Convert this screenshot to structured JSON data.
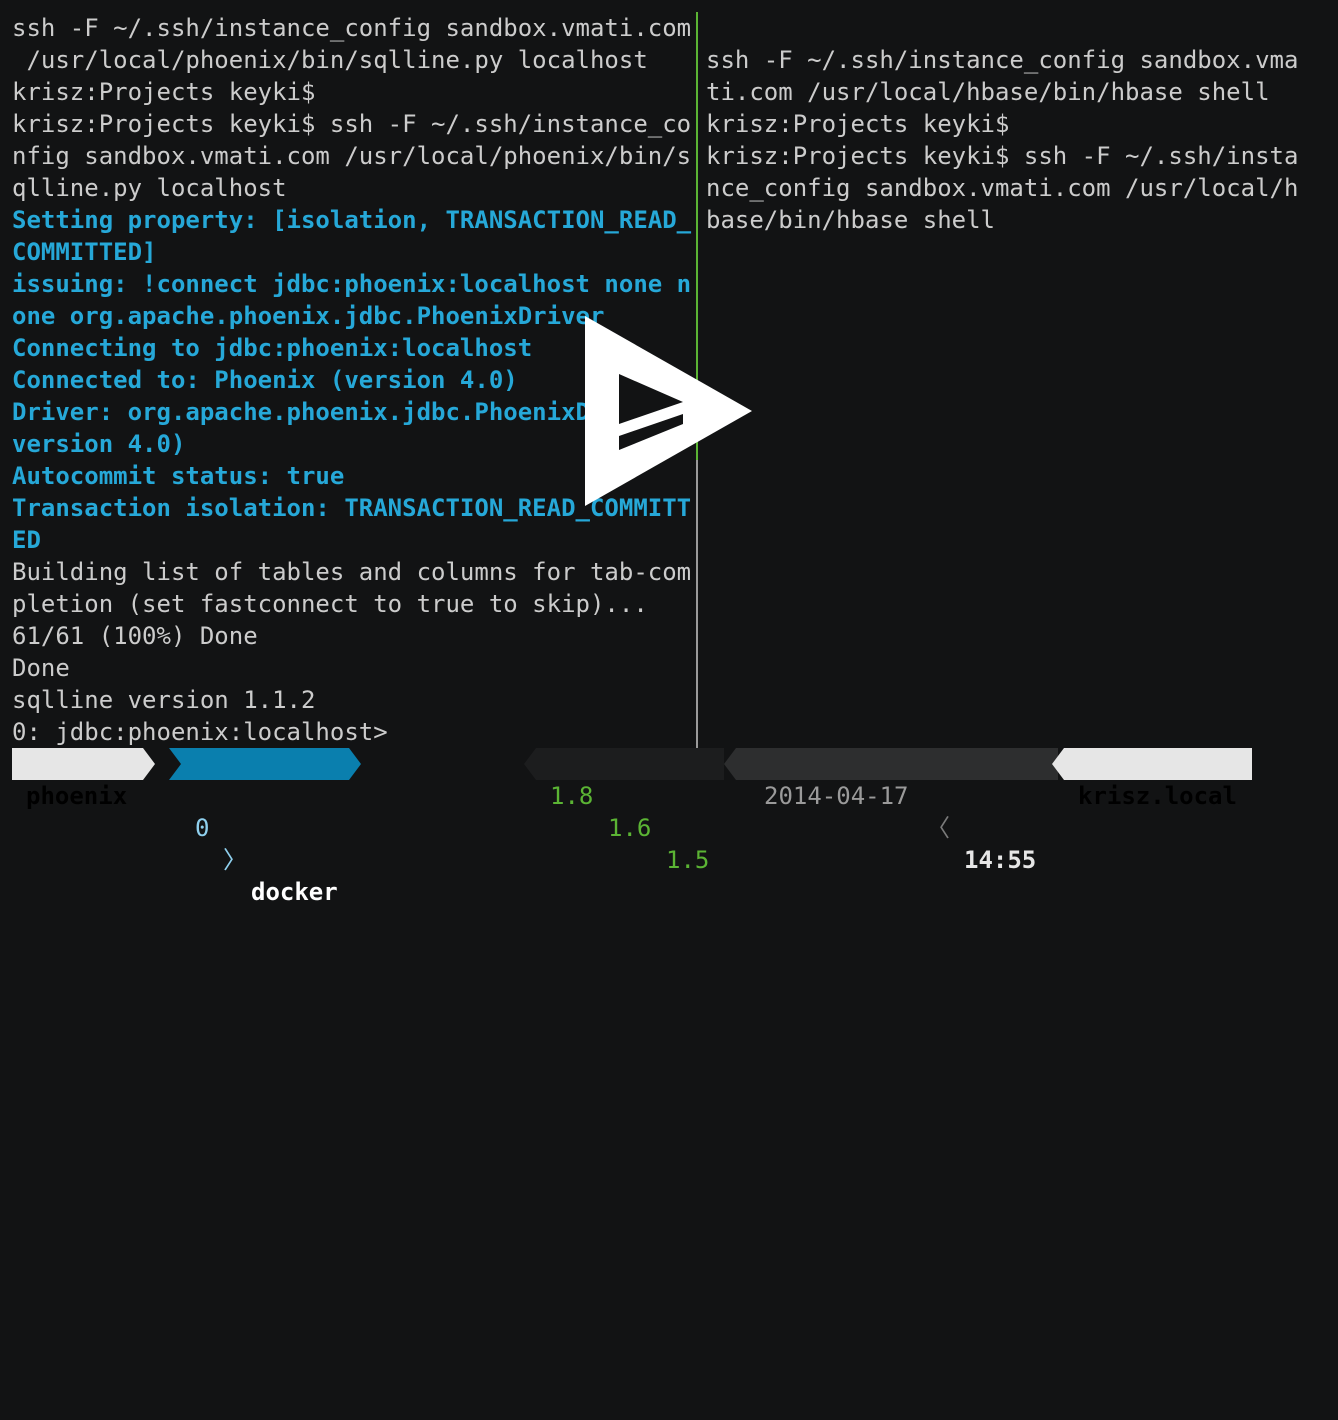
{
  "left_pane": {
    "lines": [
      {
        "text": "ssh -F ~/.ssh/instance_config sandbox.vmati.com",
        "style": "normal"
      },
      {
        "text": " /usr/local/phoenix/bin/sqlline.py localhost",
        "style": "normal"
      },
      {
        "text": "krisz:Projects keyki$",
        "style": "normal"
      },
      {
        "text": "krisz:Projects keyki$ ssh -F ~/.ssh/instance_co",
        "style": "normal"
      },
      {
        "text": "nfig sandbox.vmati.com /usr/local/phoenix/bin/s",
        "style": "normal"
      },
      {
        "text": "qlline.py localhost",
        "style": "normal"
      },
      {
        "text": "Setting property: [isolation, TRANSACTION_READ_",
        "style": "hl"
      },
      {
        "text": "COMMITTED]",
        "style": "hl"
      },
      {
        "text": "issuing: !connect jdbc:phoenix:localhost none n",
        "style": "hl"
      },
      {
        "text": "one org.apache.phoenix.jdbc.PhoenixDriver",
        "style": "hl"
      },
      {
        "text": "Connecting to jdbc:phoenix:localhost",
        "style": "hl"
      },
      {
        "text": "Connected to: Phoenix (version 4.0)",
        "style": "hl"
      },
      {
        "text": "Driver: org.apache.phoenix.jdbc.PhoenixDriver (",
        "style": "hl"
      },
      {
        "text": "version 4.0)",
        "style": "hl"
      },
      {
        "text": "Autocommit status: true",
        "style": "hl"
      },
      {
        "text": "Transaction isolation: TRANSACTION_READ_COMMITT",
        "style": "hl"
      },
      {
        "text": "ED",
        "style": "hl"
      },
      {
        "text": "Building list of tables and columns for tab-com",
        "style": "normal"
      },
      {
        "text": "pletion (set fastconnect to true to skip)...",
        "style": "normal"
      },
      {
        "text": "61/61 (100%) Done",
        "style": "normal"
      },
      {
        "text": "Done",
        "style": "normal"
      },
      {
        "text": "sqlline version 1.1.2",
        "style": "normal"
      },
      {
        "text": "0: jdbc:phoenix:localhost>",
        "style": "normal"
      }
    ]
  },
  "right_pane": {
    "lines": [
      {
        "text": "",
        "style": "normal"
      },
      {
        "text": "ssh -F ~/.ssh/instance_config sandbox.vma",
        "style": "normal"
      },
      {
        "text": "ti.com /usr/local/hbase/bin/hbase shell",
        "style": "normal"
      },
      {
        "text": "krisz:Projects keyki$",
        "style": "normal"
      },
      {
        "text": "krisz:Projects keyki$ ssh -F ~/.ssh/insta",
        "style": "normal"
      },
      {
        "text": "nce_config sandbox.vmati.com /usr/local/h",
        "style": "normal"
      },
      {
        "text": "base/bin/hbase shell",
        "style": "normal"
      }
    ]
  },
  "status_bar": {
    "session": "phoenix",
    "window_index": "0",
    "window_name": "docker",
    "load_1": "1.8",
    "load_5": "1.6",
    "load_15": "1.5",
    "date": "2014-04-17",
    "time": "14:55",
    "hostname": "krisz.local"
  },
  "overlay": {
    "icon": "play-icon"
  },
  "colors": {
    "background": "#121314",
    "text": "#cccccc",
    "highlight": "#26a8d8",
    "active_border": "#5bb434",
    "load_green": "#5bb434"
  }
}
